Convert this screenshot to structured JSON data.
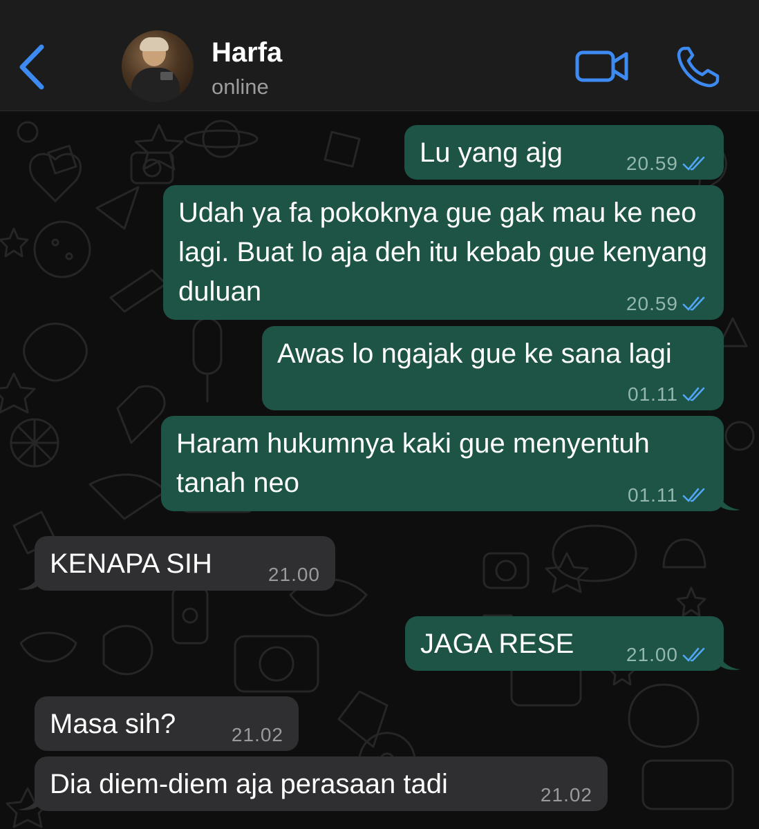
{
  "header": {
    "contact_name": "Harfa",
    "status": "online",
    "back_icon": "chevron-left-icon",
    "video_icon": "video-camera-icon",
    "call_icon": "phone-icon",
    "accent_color": "#3d8bf2"
  },
  "messages": [
    {
      "direction": "outgoing",
      "text": "Lu yang ajg",
      "time": "20.59",
      "status": "read"
    },
    {
      "direction": "outgoing",
      "text": "Udah ya fa pokoknya gue gak mau ke neo lagi. Buat lo aja deh itu kebab gue kenyang duluan",
      "time": "20.59",
      "status": "read"
    },
    {
      "direction": "outgoing",
      "text": "Awas lo ngajak gue ke sana lagi",
      "time": "01.11",
      "status": "read"
    },
    {
      "direction": "outgoing",
      "text": "Haram hukumnya kaki gue menyentuh tanah neo",
      "time": "01.11",
      "status": "read"
    },
    {
      "direction": "incoming",
      "text": "KENAPA SIH",
      "time": "21.00"
    },
    {
      "direction": "outgoing",
      "text": "JAGA RESE",
      "time": "21.00",
      "status": "read"
    },
    {
      "direction": "incoming",
      "text": "Masa sih?",
      "time": "21.02"
    },
    {
      "direction": "incoming",
      "text": "Dia diem-diem aja perasaan tadi",
      "time": "21.02"
    }
  ],
  "colors": {
    "outgoing_bubble": "#1d5446",
    "incoming_bubble": "#2f2f31",
    "read_ticks": "#53a6f5"
  }
}
